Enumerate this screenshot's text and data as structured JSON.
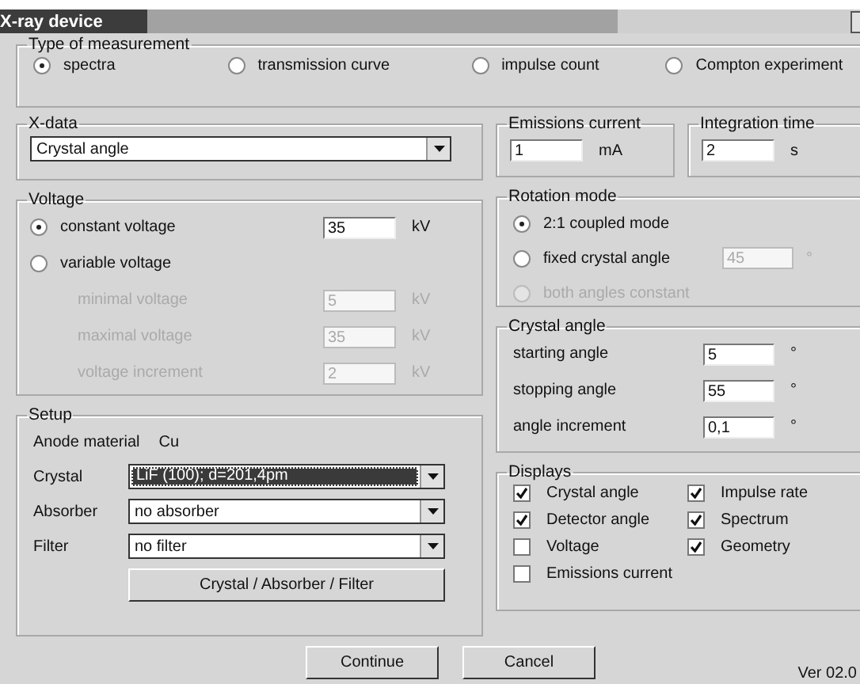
{
  "window": {
    "title": "X-ray device"
  },
  "measurement_type": {
    "label": "Type of measurement",
    "options": [
      {
        "label": "spectra",
        "selected": true
      },
      {
        "label": "transmission curve",
        "selected": false
      },
      {
        "label": "impulse count",
        "selected": false
      },
      {
        "label": "Compton experiment",
        "selected": false
      }
    ]
  },
  "x_data": {
    "label": "X-data",
    "value": "Crystal angle"
  },
  "emissions_current": {
    "label": "Emissions current",
    "value": "1",
    "unit": "mA"
  },
  "integration_time": {
    "label": "Integration time",
    "value": "2",
    "unit": "s"
  },
  "voltage": {
    "label": "Voltage",
    "modes": [
      {
        "label": "constant voltage",
        "selected": true,
        "value": "35",
        "unit": "kV"
      },
      {
        "label": "variable voltage",
        "selected": false
      }
    ],
    "fields": [
      {
        "label": "minimal voltage",
        "value": "5",
        "unit": "kV",
        "disabled": true
      },
      {
        "label": "maximal voltage",
        "value": "35",
        "unit": "kV",
        "disabled": true
      },
      {
        "label": "voltage increment",
        "value": "2",
        "unit": "kV",
        "disabled": true
      }
    ]
  },
  "setup": {
    "label": "Setup",
    "anode_label": "Anode material",
    "anode_value": "Cu",
    "selects": [
      {
        "label": "Crystal",
        "value": "LiF (100); d=201,4pm",
        "focused": true
      },
      {
        "label": "Absorber",
        "value": "no absorber",
        "focused": false
      },
      {
        "label": "Filter",
        "value": "no filter",
        "focused": false
      }
    ],
    "button": "Crystal / Absorber / Filter"
  },
  "rotation_mode": {
    "label": "Rotation mode",
    "options": [
      {
        "label": "2:1 coupled mode",
        "selected": true,
        "disabled": false
      },
      {
        "label": "fixed crystal angle",
        "selected": false,
        "disabled": false,
        "field": {
          "value": "45",
          "unit": "°",
          "disabled": true
        }
      },
      {
        "label": "both angles constant",
        "selected": false,
        "disabled": true
      }
    ]
  },
  "crystal_angle": {
    "label": "Crystal angle",
    "fields": [
      {
        "label": "starting angle",
        "value": "5",
        "unit": "°"
      },
      {
        "label": "stopping angle",
        "value": "55",
        "unit": "°"
      },
      {
        "label": "angle increment",
        "value": "0,1",
        "unit": "°"
      }
    ]
  },
  "displays": {
    "label": "Displays",
    "items": [
      {
        "label": "Crystal angle",
        "checked": true
      },
      {
        "label": "Impulse rate",
        "checked": true
      },
      {
        "label": "Detector angle",
        "checked": true
      },
      {
        "label": "Spectrum",
        "checked": true
      },
      {
        "label": "Voltage",
        "checked": false
      },
      {
        "label": "Geometry",
        "checked": true
      },
      {
        "label": "Emissions current",
        "checked": false
      }
    ]
  },
  "buttons": [
    "Continue",
    "Cancel"
  ],
  "version": "Ver 02.0"
}
